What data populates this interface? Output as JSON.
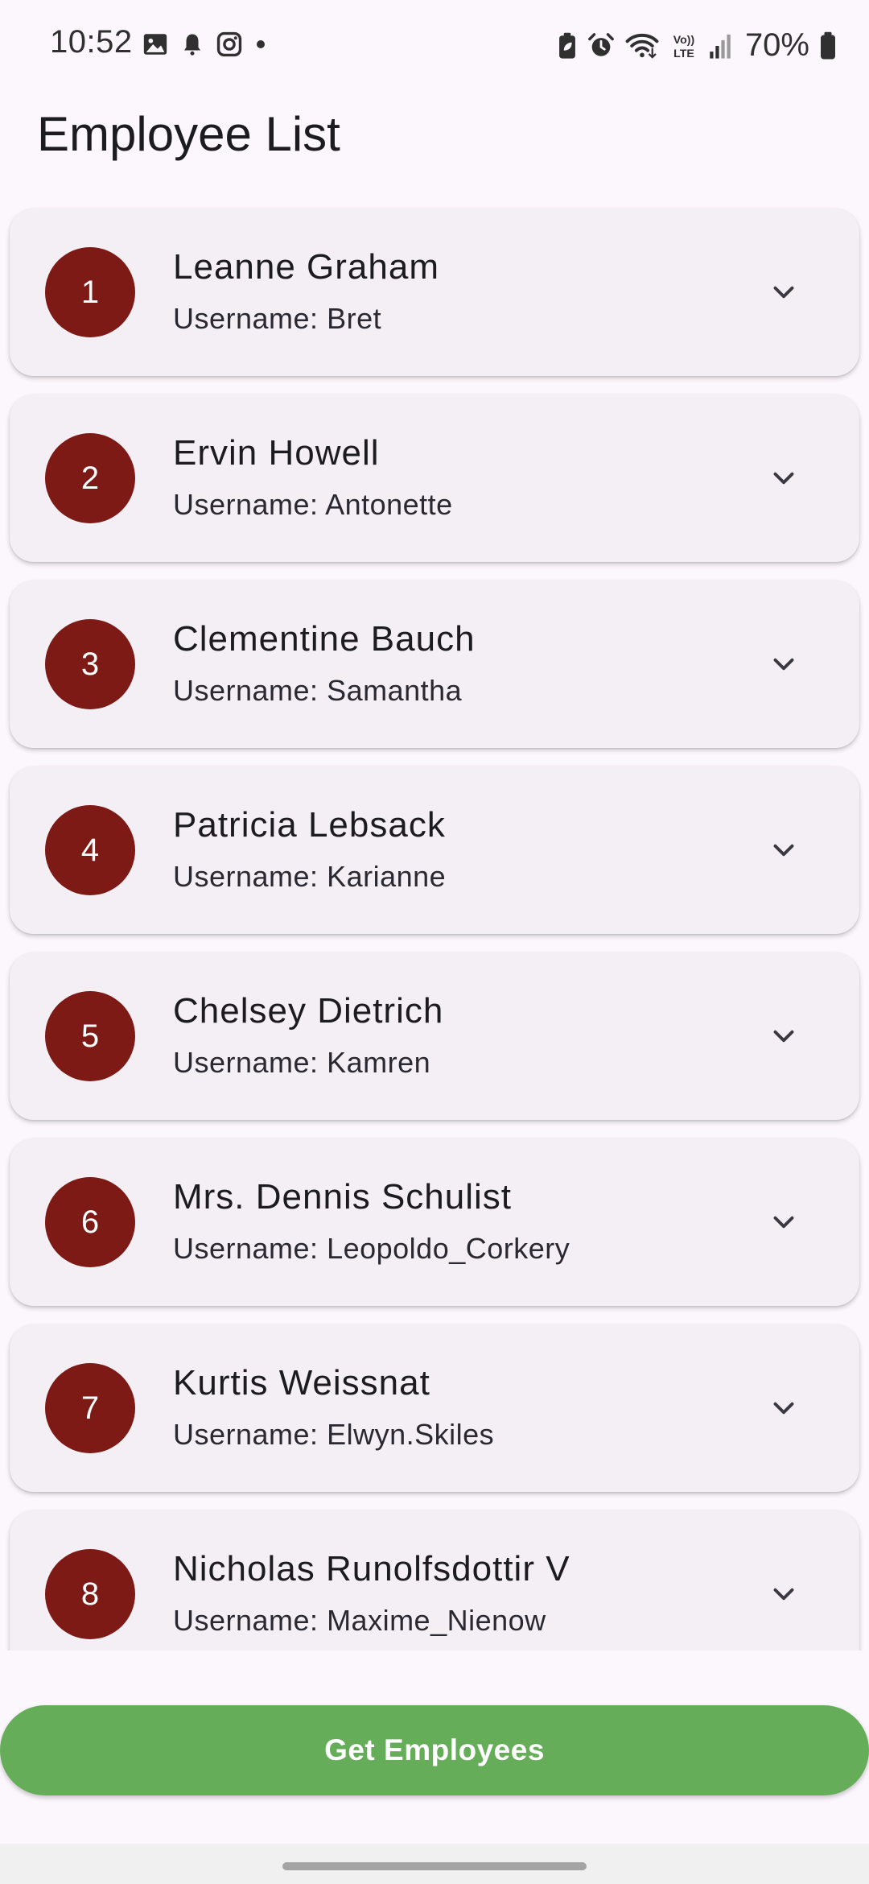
{
  "status_bar": {
    "time": "10:52",
    "left_icons": [
      "image-icon",
      "bell-icon",
      "instagram-icon",
      "dot-icon"
    ],
    "right_icons": [
      "battery-saver-icon",
      "alarm-icon",
      "wifi-icon",
      "volte-icon",
      "signal-icon"
    ],
    "volte_label_top": "Vo))",
    "volte_label_bottom": "LTE",
    "battery_percent": "70%"
  },
  "header": {
    "title": "Employee List"
  },
  "employees": [
    {
      "id": "1",
      "name": "Leanne Graham",
      "username": "Username: Bret"
    },
    {
      "id": "2",
      "name": "Ervin Howell",
      "username": "Username: Antonette"
    },
    {
      "id": "3",
      "name": "Clementine Bauch",
      "username": "Username: Samantha"
    },
    {
      "id": "4",
      "name": "Patricia Lebsack",
      "username": "Username: Karianne"
    },
    {
      "id": "5",
      "name": "Chelsey Dietrich",
      "username": "Username: Kamren"
    },
    {
      "id": "6",
      "name": "Mrs. Dennis Schulist",
      "username": "Username: Leopoldo_Corkery"
    },
    {
      "id": "7",
      "name": "Kurtis Weissnat",
      "username": "Username: Elwyn.Skiles"
    },
    {
      "id": "8",
      "name": "Nicholas Runolfsdottir V",
      "username": "Username: Maxime_Nienow"
    }
  ],
  "actions": {
    "get_employees_label": "Get Employees"
  },
  "colors": {
    "background": "#FCF7FC",
    "card": "#F3EFF5",
    "avatar": "#7D1A16",
    "button": "#66AD5A",
    "text": "#1C1B1F"
  }
}
